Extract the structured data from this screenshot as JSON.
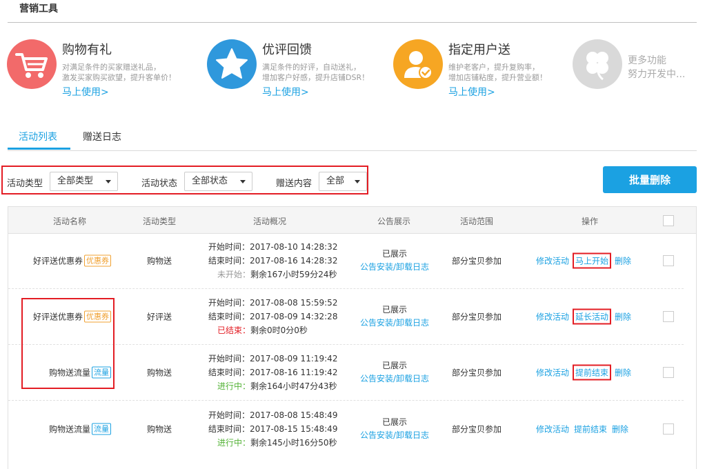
{
  "header": {
    "title": "营销工具"
  },
  "tools": [
    {
      "name": "购物有礼",
      "desc1": "对满足条件的买家赠送礼品，",
      "desc2": "激发买家购买欲望，提升客单价！",
      "link": "马上使用>",
      "icon": "cart-icon",
      "color": "#f26a6a"
    },
    {
      "name": "优评回馈",
      "desc1": "满足条件的好评，自动送礼，",
      "desc2": "增加客户好感，提升店铺DSR！",
      "link": "马上使用>",
      "icon": "star-icon",
      "color": "#2f98dc"
    },
    {
      "name": "指定用户送",
      "desc1": "维护老客户，提升复购率，",
      "desc2": "增加店铺粘度，提升营业额！",
      "link": "马上使用>",
      "icon": "user-check-icon",
      "color": "#f6a623"
    },
    {
      "more1": "更多功能",
      "more2": "努力开发中...",
      "icon": "clover-icon",
      "color": "#d9d9d9"
    }
  ],
  "tabs": [
    {
      "label": "活动列表"
    },
    {
      "label": "赠送日志"
    }
  ],
  "filters": {
    "type_label": "活动类型",
    "type_value": "全部类型",
    "status_label": "活动状态",
    "status_value": "全部状态",
    "content_label": "赠送内容",
    "content_value": "全部"
  },
  "bulk_delete_label": "批量删除",
  "table": {
    "headers": [
      "活动名称",
      "活动类型",
      "活动概况",
      "公告展示",
      "活动范围",
      "操作"
    ],
    "rows": [
      {
        "name": "好评送优惠券",
        "tag": "优惠券",
        "type": "购物送",
        "start": "开始时间：2017-08-10 14:28:32",
        "end": "结束时间：2017-08-16 14:28:32",
        "status": "未开始：",
        "remain": "剩余167小时59分24秒",
        "notice": "已展示",
        "notice_link": "公告安装/卸载日志",
        "scope": "部分宝贝参加",
        "op1": "修改活动",
        "op2": "马上开始",
        "op3": "删除"
      },
      {
        "name": "好评送优惠券",
        "tag": "优惠券",
        "type": "好评送",
        "start": "开始时间：2017-08-08 15:59:52",
        "end": "结束时间：2017-08-09 14:32:28",
        "status": "已结束：",
        "remain": "剩余0时0分0秒",
        "notice": "已展示",
        "notice_link": "公告安装/卸载日志",
        "scope": "部分宝贝参加",
        "op1": "修改活动",
        "op2": "延长活动",
        "op3": "删除"
      },
      {
        "name": "购物送流量",
        "tag": "流量",
        "type": "购物送",
        "start": "开始时间：2017-08-09 11:19:42",
        "end": "结束时间：2017-08-16 11:19:42",
        "status": "进行中：",
        "remain": "剩余164小时47分43秒",
        "notice": "已展示",
        "notice_link": "公告安装/卸载日志",
        "scope": "部分宝贝参加",
        "op1": "修改活动",
        "op2": "提前结束",
        "op3": "删除"
      },
      {
        "name": "购物送流量",
        "tag": "流量",
        "type": "购物送",
        "start": "开始时间：2017-08-08 15:48:49",
        "end": "结束时间：2017-08-15 15:48:49",
        "status": "进行中：",
        "remain": "剩余145小时16分50秒",
        "notice": "已展示",
        "notice_link": "公告安装/卸载日志",
        "scope": "部分宝贝参加",
        "op1": "修改活动",
        "op2": "提前结束",
        "op3": "删除"
      }
    ]
  }
}
